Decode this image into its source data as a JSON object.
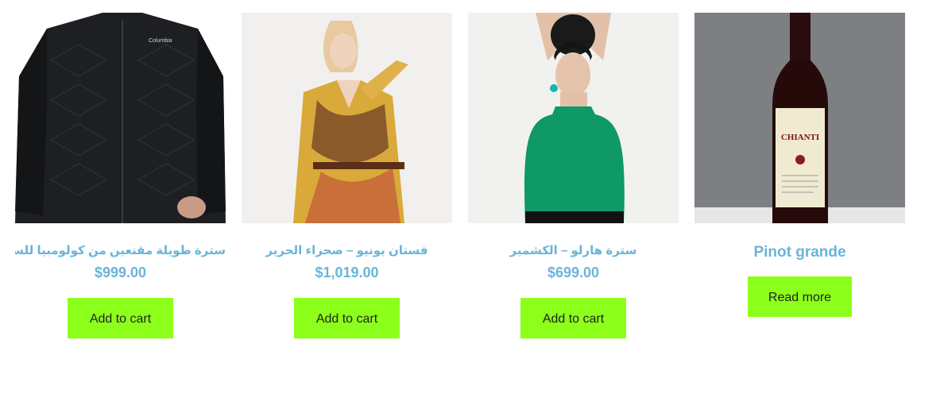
{
  "products": [
    {
      "title": "سترة طويلة مقنعين من كولومبيا للسيدات",
      "price": "$999.00",
      "button": "Add to cart",
      "image_brand": "Columbia"
    },
    {
      "title": "فستان يونيو – صحراء الحرير",
      "price": "$1,019.00",
      "button": "Add to cart"
    },
    {
      "title": "سترة هارلو – الكشمير",
      "price": "$699.00",
      "button": "Add to cart"
    },
    {
      "title": "Pinot grande",
      "button": "Read more",
      "image_label": "CHIANTI"
    }
  ],
  "colors": {
    "title": "#6ab4d9",
    "button_bg": "#8cff1a",
    "button_text": "#222222"
  }
}
